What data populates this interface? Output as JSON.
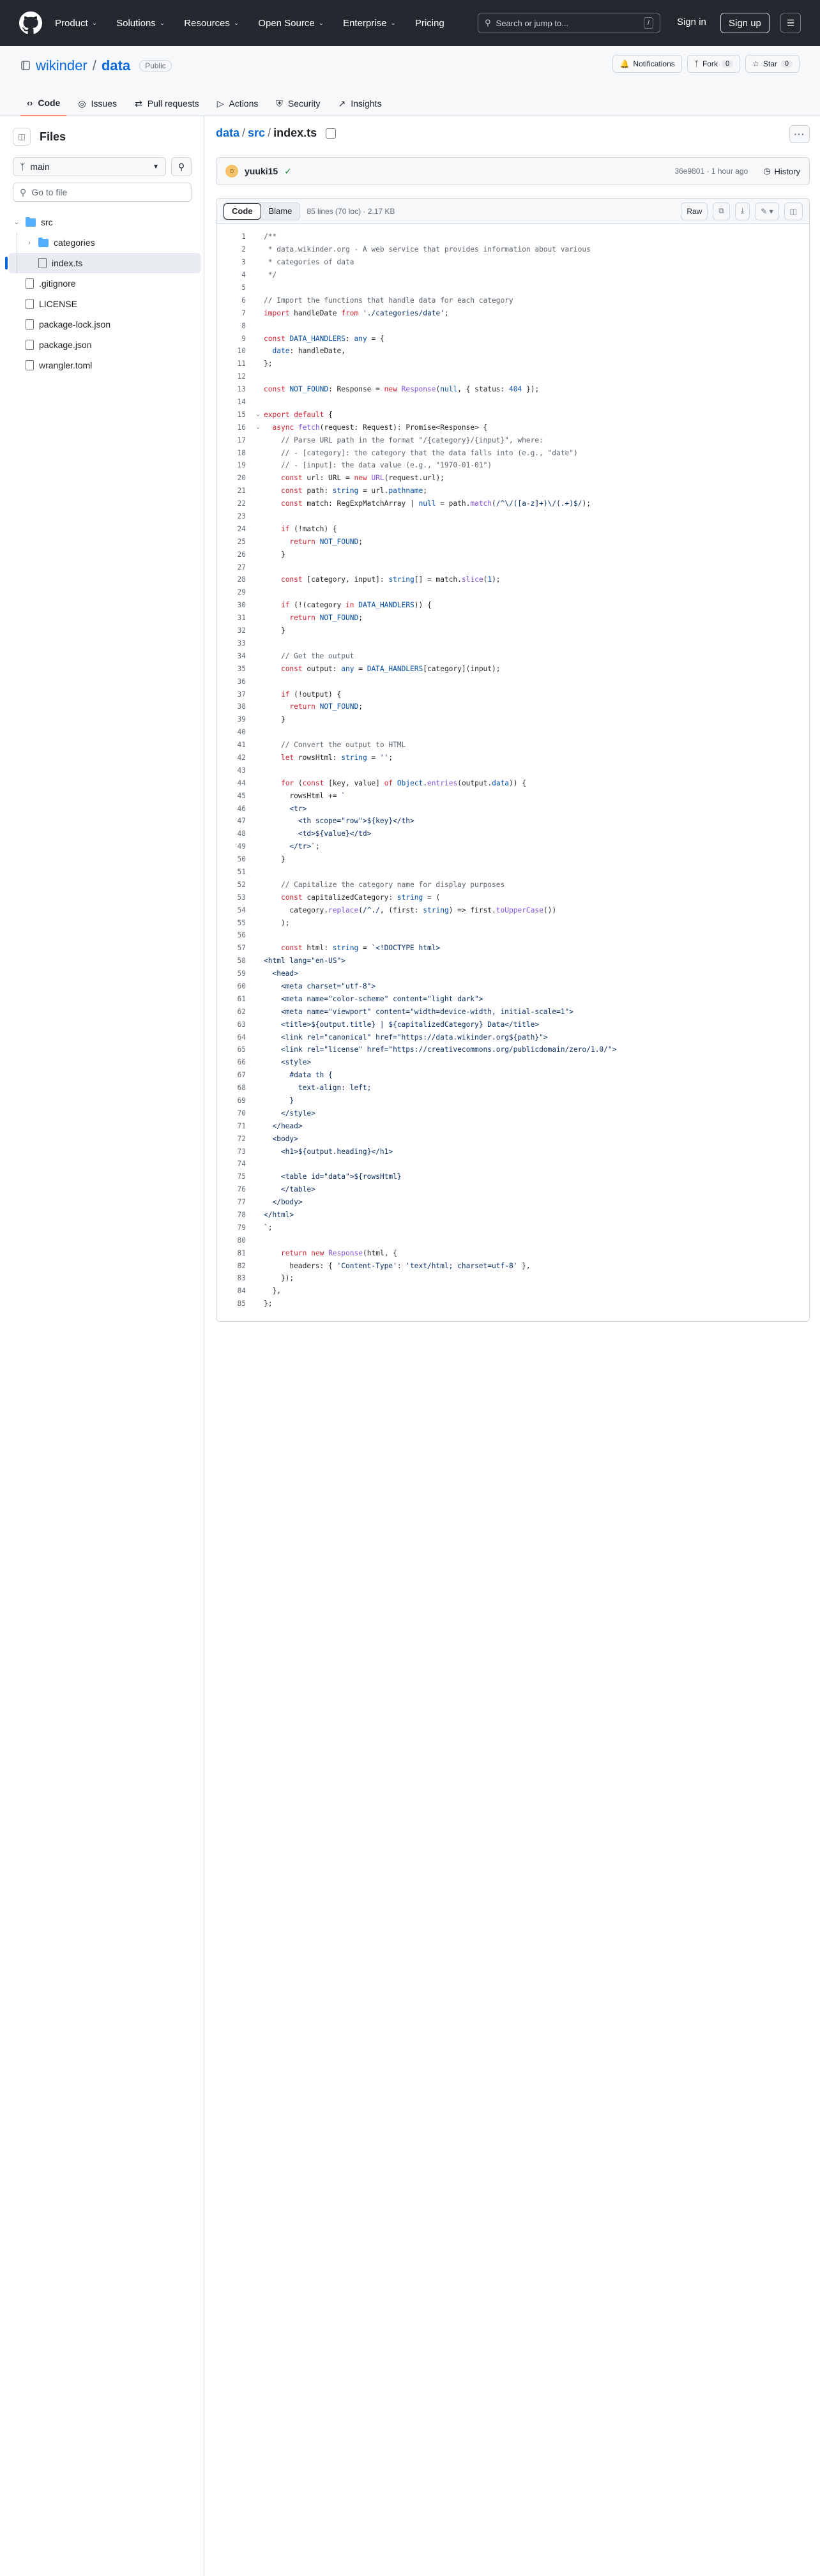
{
  "header": {
    "nav": [
      "Product",
      "Solutions",
      "Resources",
      "Open Source",
      "Enterprise",
      "Pricing"
    ],
    "search_placeholder": "Search or jump to...",
    "search_kbd": "/",
    "sign_in": "Sign in",
    "sign_up": "Sign up"
  },
  "repo": {
    "owner": "wikinder",
    "name": "data",
    "visibility": "Public",
    "notifications": "Notifications",
    "fork": "Fork",
    "fork_count": "0",
    "star": "Star",
    "star_count": "0",
    "tabs": [
      "Code",
      "Issues",
      "Pull requests",
      "Actions",
      "Security",
      "Insights"
    ]
  },
  "sidebar": {
    "title": "Files",
    "branch": "main",
    "goto_placeholder": "Go to file",
    "tree": [
      {
        "label": "src",
        "type": "folder",
        "depth": 0,
        "open": true
      },
      {
        "label": "categories",
        "type": "folder",
        "depth": 1,
        "open": false
      },
      {
        "label": "index.ts",
        "type": "file",
        "depth": 1,
        "selected": true
      },
      {
        "label": ".gitignore",
        "type": "file",
        "depth": 0
      },
      {
        "label": "LICENSE",
        "type": "file",
        "depth": 0
      },
      {
        "label": "package-lock.json",
        "type": "file",
        "depth": 0
      },
      {
        "label": "package.json",
        "type": "file",
        "depth": 0
      },
      {
        "label": "wrangler.toml",
        "type": "file",
        "depth": 0
      }
    ]
  },
  "breadcrumb": {
    "repo": "data",
    "dir": "src",
    "file": "index.ts"
  },
  "commit": {
    "author": "yuuki15",
    "hash_time": "36e9801 · 1 hour ago",
    "history": "History"
  },
  "file": {
    "tab_code": "Code",
    "tab_blame": "Blame",
    "info": "85 lines (70 loc) · 2.17 KB",
    "raw": "Raw"
  },
  "code_lines": [
    [
      [
        "c",
        "/**"
      ]
    ],
    [
      [
        "c",
        " * data.wikinder.org - A web service that provides information about various"
      ]
    ],
    [
      [
        "c",
        " * categories of data"
      ]
    ],
    [
      [
        "c",
        " */"
      ]
    ],
    [],
    [
      [
        "c",
        "// Import the functions that handle data for each category"
      ]
    ],
    [
      [
        "k",
        "import"
      ],
      [
        "p",
        " handleDate "
      ],
      [
        "k",
        "from"
      ],
      [
        "p",
        " "
      ],
      [
        "s",
        "'./categories/date'"
      ],
      [
        "p",
        ";"
      ]
    ],
    [],
    [
      [
        "k",
        "const"
      ],
      [
        "p",
        " "
      ],
      [
        "v",
        "DATA_HANDLERS"
      ],
      [
        "p",
        ": "
      ],
      [
        "v",
        "any"
      ],
      [
        "p",
        " = {"
      ]
    ],
    [
      [
        "p",
        "  "
      ],
      [
        "v",
        "date"
      ],
      [
        "p",
        ": handleDate,"
      ]
    ],
    [
      [
        "p",
        "};"
      ]
    ],
    [],
    [
      [
        "k",
        "const"
      ],
      [
        "p",
        " "
      ],
      [
        "v",
        "NOT_FOUND"
      ],
      [
        "p",
        ": Response = "
      ],
      [
        "k",
        "new"
      ],
      [
        "p",
        " "
      ],
      [
        "f",
        "Response"
      ],
      [
        "p",
        "("
      ],
      [
        "v",
        "null"
      ],
      [
        "p",
        ", { status: "
      ],
      [
        "v",
        "404"
      ],
      [
        "p",
        " });"
      ]
    ],
    [],
    [
      [
        "k",
        "export"
      ],
      [
        "p",
        " "
      ],
      [
        "k",
        "default"
      ],
      [
        "p",
        " {"
      ]
    ],
    [
      [
        "p",
        "  "
      ],
      [
        "k",
        "async"
      ],
      [
        "p",
        " "
      ],
      [
        "f",
        "fetch"
      ],
      [
        "p",
        "(request: Request): Promise<Response> {"
      ]
    ],
    [
      [
        "c",
        "    // Parse URL path in the format \"/{category}/{input}\", where:"
      ]
    ],
    [
      [
        "c",
        "    // - [category]: the category that the data falls into (e.g., \"date\")"
      ]
    ],
    [
      [
        "c",
        "    // - [input]: the data value (e.g., \"1970-01-01\")"
      ]
    ],
    [
      [
        "p",
        "    "
      ],
      [
        "k",
        "const"
      ],
      [
        "p",
        " url: URL = "
      ],
      [
        "k",
        "new"
      ],
      [
        "p",
        " "
      ],
      [
        "f",
        "URL"
      ],
      [
        "p",
        "(request.url);"
      ]
    ],
    [
      [
        "p",
        "    "
      ],
      [
        "k",
        "const"
      ],
      [
        "p",
        " path: "
      ],
      [
        "v",
        "string"
      ],
      [
        "p",
        " = url."
      ],
      [
        "v",
        "pathname"
      ],
      [
        "p",
        ";"
      ]
    ],
    [
      [
        "p",
        "    "
      ],
      [
        "k",
        "const"
      ],
      [
        "p",
        " match: RegExpMatchArray | "
      ],
      [
        "v",
        "null"
      ],
      [
        "p",
        " = path."
      ],
      [
        "f",
        "match"
      ],
      [
        "p",
        "("
      ],
      [
        "s",
        "/^\\/([a-z]+)\\/(.+)$/"
      ],
      [
        "p",
        ");"
      ]
    ],
    [],
    [
      [
        "p",
        "    "
      ],
      [
        "k",
        "if"
      ],
      [
        "p",
        " (!match) {"
      ]
    ],
    [
      [
        "p",
        "      "
      ],
      [
        "k",
        "return"
      ],
      [
        "p",
        " "
      ],
      [
        "v",
        "NOT_FOUND"
      ],
      [
        "p",
        ";"
      ]
    ],
    [
      [
        "p",
        "    }"
      ]
    ],
    [],
    [
      [
        "p",
        "    "
      ],
      [
        "k",
        "const"
      ],
      [
        "p",
        " [category, input]: "
      ],
      [
        "v",
        "string"
      ],
      [
        "p",
        "[] = match."
      ],
      [
        "f",
        "slice"
      ],
      [
        "p",
        "("
      ],
      [
        "v",
        "1"
      ],
      [
        "p",
        ");"
      ]
    ],
    [],
    [
      [
        "p",
        "    "
      ],
      [
        "k",
        "if"
      ],
      [
        "p",
        " (!(category "
      ],
      [
        "k",
        "in"
      ],
      [
        "p",
        " "
      ],
      [
        "v",
        "DATA_HANDLERS"
      ],
      [
        "p",
        ")) {"
      ]
    ],
    [
      [
        "p",
        "      "
      ],
      [
        "k",
        "return"
      ],
      [
        "p",
        " "
      ],
      [
        "v",
        "NOT_FOUND"
      ],
      [
        "p",
        ";"
      ]
    ],
    [
      [
        "p",
        "    }"
      ]
    ],
    [],
    [
      [
        "c",
        "    // Get the output"
      ]
    ],
    [
      [
        "p",
        "    "
      ],
      [
        "k",
        "const"
      ],
      [
        "p",
        " output: "
      ],
      [
        "v",
        "any"
      ],
      [
        "p",
        " = "
      ],
      [
        "v",
        "DATA_HANDLERS"
      ],
      [
        "p",
        "[category](input);"
      ]
    ],
    [],
    [
      [
        "p",
        "    "
      ],
      [
        "k",
        "if"
      ],
      [
        "p",
        " (!output) {"
      ]
    ],
    [
      [
        "p",
        "      "
      ],
      [
        "k",
        "return"
      ],
      [
        "p",
        " "
      ],
      [
        "v",
        "NOT_FOUND"
      ],
      [
        "p",
        ";"
      ]
    ],
    [
      [
        "p",
        "    }"
      ]
    ],
    [],
    [
      [
        "c",
        "    // Convert the output to HTML"
      ]
    ],
    [
      [
        "p",
        "    "
      ],
      [
        "k",
        "let"
      ],
      [
        "p",
        " rowsHtml: "
      ],
      [
        "v",
        "string"
      ],
      [
        "p",
        " = "
      ],
      [
        "s",
        "''"
      ],
      [
        "p",
        ";"
      ]
    ],
    [],
    [
      [
        "p",
        "    "
      ],
      [
        "k",
        "for"
      ],
      [
        "p",
        " ("
      ],
      [
        "k",
        "const"
      ],
      [
        "p",
        " [key, value] "
      ],
      [
        "k",
        "of"
      ],
      [
        "p",
        " "
      ],
      [
        "v",
        "Object"
      ],
      [
        "p",
        "."
      ],
      [
        "f",
        "entries"
      ],
      [
        "p",
        "(output."
      ],
      [
        "v",
        "data"
      ],
      [
        "p",
        ")) {"
      ]
    ],
    [
      [
        "p",
        "      rowsHtml += "
      ],
      [
        "s",
        "`"
      ]
    ],
    [
      [
        "s",
        "      <tr>"
      ]
    ],
    [
      [
        "s",
        "        <th scope=\"row\">${key}</th>"
      ]
    ],
    [
      [
        "s",
        "        <td>${value}</td>"
      ]
    ],
    [
      [
        "s",
        "      </tr>`"
      ],
      [
        "p",
        ";"
      ]
    ],
    [
      [
        "p",
        "    }"
      ]
    ],
    [],
    [
      [
        "c",
        "    // Capitalize the category name for display purposes"
      ]
    ],
    [
      [
        "p",
        "    "
      ],
      [
        "k",
        "const"
      ],
      [
        "p",
        " capitalizedCategory: "
      ],
      [
        "v",
        "string"
      ],
      [
        "p",
        " = ("
      ]
    ],
    [
      [
        "p",
        "      category."
      ],
      [
        "f",
        "replace"
      ],
      [
        "p",
        "("
      ],
      [
        "s",
        "/^./"
      ],
      [
        "p",
        ", (first: "
      ],
      [
        "v",
        "string"
      ],
      [
        "p",
        ") => first."
      ],
      [
        "f",
        "toUpperCase"
      ],
      [
        "p",
        "())"
      ]
    ],
    [
      [
        "p",
        "    );"
      ]
    ],
    [],
    [
      [
        "p",
        "    "
      ],
      [
        "k",
        "const"
      ],
      [
        "p",
        " html: "
      ],
      [
        "v",
        "string"
      ],
      [
        "p",
        " = "
      ],
      [
        "s",
        "`<!DOCTYPE html>"
      ]
    ],
    [
      [
        "s",
        "<html lang=\"en-US\">"
      ]
    ],
    [
      [
        "s",
        "  <head>"
      ]
    ],
    [
      [
        "s",
        "    <meta charset=\"utf-8\">"
      ]
    ],
    [
      [
        "s",
        "    <meta name=\"color-scheme\" content=\"light dark\">"
      ]
    ],
    [
      [
        "s",
        "    <meta name=\"viewport\" content=\"width=device-width, initial-scale=1\">"
      ]
    ],
    [
      [
        "s",
        "    <title>${output.title} | ${capitalizedCategory} Data</title>"
      ]
    ],
    [
      [
        "s",
        "    <link rel=\"canonical\" href=\"https://data.wikinder.org${path}\">"
      ]
    ],
    [
      [
        "s",
        "    <link rel=\"license\" href=\"https://creativecommons.org/publicdomain/zero/1.0/\">"
      ]
    ],
    [
      [
        "s",
        "    <style>"
      ]
    ],
    [
      [
        "s",
        "      #data th {"
      ]
    ],
    [
      [
        "s",
        "        text-align: left;"
      ]
    ],
    [
      [
        "s",
        "      }"
      ]
    ],
    [
      [
        "s",
        "    </style>"
      ]
    ],
    [
      [
        "s",
        "  </head>"
      ]
    ],
    [
      [
        "s",
        "  <body>"
      ]
    ],
    [
      [
        "s",
        "    <h1>${output.heading}</h1>"
      ]
    ],
    [],
    [
      [
        "s",
        "    <table id=\"data\">${rowsHtml}"
      ]
    ],
    [
      [
        "s",
        "    </table>"
      ]
    ],
    [
      [
        "s",
        "  </body>"
      ]
    ],
    [
      [
        "s",
        "</html>"
      ]
    ],
    [
      [
        "s",
        "`"
      ],
      [
        "p",
        ";"
      ]
    ],
    [],
    [
      [
        "p",
        "    "
      ],
      [
        "k",
        "return"
      ],
      [
        "p",
        " "
      ],
      [
        "k",
        "new"
      ],
      [
        "p",
        " "
      ],
      [
        "f",
        "Response"
      ],
      [
        "p",
        "(html, {"
      ]
    ],
    [
      [
        "p",
        "      headers: { "
      ],
      [
        "s",
        "'Content-Type'"
      ],
      [
        "p",
        ": "
      ],
      [
        "s",
        "'text/html; charset=utf-8'"
      ],
      [
        "p",
        " },"
      ]
    ],
    [
      [
        "p",
        "    });"
      ]
    ],
    [
      [
        "p",
        "  },"
      ]
    ],
    [
      [
        "p",
        "};"
      ]
    ]
  ],
  "fold_lines": [
    15,
    16
  ],
  "colors": {
    "accent": "#0969da",
    "header_bg": "#24292f",
    "tab_underline": "#fd8c73"
  }
}
